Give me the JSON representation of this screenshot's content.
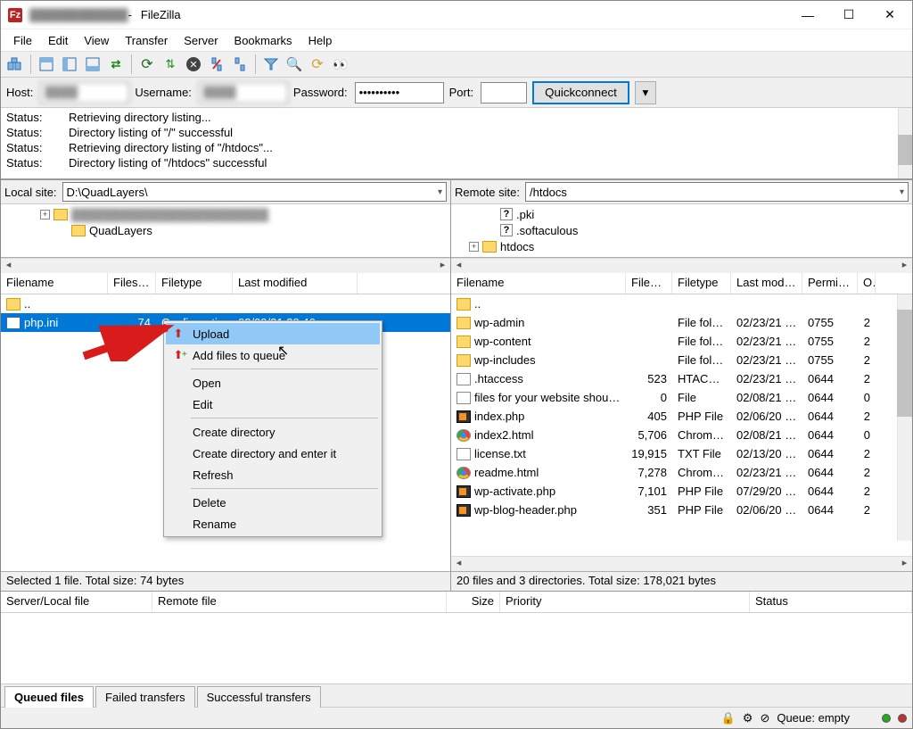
{
  "title": {
    "app_name": "FileZilla"
  },
  "menu": {
    "items": [
      "File",
      "Edit",
      "View",
      "Transfer",
      "Server",
      "Bookmarks",
      "Help"
    ]
  },
  "quickconnect": {
    "host_label": "Host:",
    "username_label": "Username:",
    "password_label": "Password:",
    "password_value": "••••••••••",
    "port_label": "Port:",
    "button": "Quickconnect"
  },
  "log": [
    {
      "label": "Status:",
      "text": "Retrieving directory listing..."
    },
    {
      "label": "Status:",
      "text": "Directory listing of \"/\" successful"
    },
    {
      "label": "Status:",
      "text": "Retrieving directory listing of \"/htdocs\"..."
    },
    {
      "label": "Status:",
      "text": "Directory listing of \"/htdocs\" successful"
    }
  ],
  "local": {
    "site_label": "Local site:",
    "site_path": "D:\\QuadLayers\\",
    "tree": [
      {
        "indent": 40,
        "sq": "+",
        "icon": "fld",
        "label": "",
        "blur": true
      },
      {
        "indent": 60,
        "sq": "",
        "icon": "fld",
        "label": "QuadLayers"
      }
    ],
    "columns": [
      "Filename",
      "Filesize",
      "Filetype",
      "Last modified"
    ],
    "rows": [
      {
        "icon": "fld",
        "name": "..",
        "size": "",
        "type": "",
        "mod": "",
        "sel": false
      },
      {
        "icon": "ini",
        "name": "php.ini",
        "size": "74",
        "type": "Configurati...",
        "mod": "03/09/21 20:46",
        "sel": true
      }
    ],
    "status": "Selected 1 file. Total size: 74 bytes"
  },
  "remote": {
    "site_label": "Remote site:",
    "site_path": "/htdocs",
    "tree": [
      {
        "indent": 36,
        "sq": "",
        "icon": "q",
        "label": ".pki"
      },
      {
        "indent": 36,
        "sq": "",
        "icon": "q",
        "label": ".softaculous"
      },
      {
        "indent": 16,
        "sq": "+",
        "icon": "fld",
        "label": "htdocs"
      }
    ],
    "columns": [
      "Filename",
      "Filesize",
      "Filetype",
      "Last modifi...",
      "Permissi...",
      "O"
    ],
    "rows": [
      {
        "icon": "fld",
        "name": "..",
        "size": "",
        "type": "",
        "mod": "",
        "perm": "",
        "own": ""
      },
      {
        "icon": "fld",
        "name": "wp-admin",
        "size": "",
        "type": "File folder",
        "mod": "02/23/21 0...",
        "perm": "0755",
        "own": "2"
      },
      {
        "icon": "fld",
        "name": "wp-content",
        "size": "",
        "type": "File folder",
        "mod": "02/23/21 0...",
        "perm": "0755",
        "own": "2"
      },
      {
        "icon": "fld",
        "name": "wp-includes",
        "size": "",
        "type": "File folder",
        "mod": "02/23/21 0...",
        "perm": "0755",
        "own": "2"
      },
      {
        "icon": "doc",
        "name": ".htaccess",
        "size": "523",
        "type": "HTACCE...",
        "mod": "02/23/21 0...",
        "perm": "0644",
        "own": "2"
      },
      {
        "icon": "doc",
        "name": "files for your website shoul...",
        "size": "0",
        "type": "File",
        "mod": "02/08/21 1...",
        "perm": "0644",
        "own": "0"
      },
      {
        "icon": "php",
        "name": "index.php",
        "size": "405",
        "type": "PHP File",
        "mod": "02/06/20 2...",
        "perm": "0644",
        "own": "2"
      },
      {
        "icon": "chrome",
        "name": "index2.html",
        "size": "5,706",
        "type": "Chrome ...",
        "mod": "02/08/21 1...",
        "perm": "0644",
        "own": "0"
      },
      {
        "icon": "doc",
        "name": "license.txt",
        "size": "19,915",
        "type": "TXT File",
        "mod": "02/13/20 0...",
        "perm": "0644",
        "own": "2"
      },
      {
        "icon": "chrome",
        "name": "readme.html",
        "size": "7,278",
        "type": "Chrome ...",
        "mod": "02/23/21 0...",
        "perm": "0644",
        "own": "2"
      },
      {
        "icon": "php",
        "name": "wp-activate.php",
        "size": "7,101",
        "type": "PHP File",
        "mod": "07/29/20 0...",
        "perm": "0644",
        "own": "2"
      },
      {
        "icon": "php",
        "name": "wp-blog-header.php",
        "size": "351",
        "type": "PHP File",
        "mod": "02/06/20 2...",
        "perm": "0644",
        "own": "2"
      }
    ],
    "status": "20 files and 3 directories. Total size: 178,021 bytes"
  },
  "context_menu": {
    "items": [
      {
        "label": "Upload",
        "icon": "↑",
        "hl": true
      },
      {
        "label": "Add files to queue",
        "icon": "↑+"
      },
      {
        "sep": true
      },
      {
        "label": "Open"
      },
      {
        "label": "Edit"
      },
      {
        "sep": true
      },
      {
        "label": "Create directory"
      },
      {
        "label": "Create directory and enter it"
      },
      {
        "label": "Refresh"
      },
      {
        "sep": true
      },
      {
        "label": "Delete"
      },
      {
        "label": "Rename"
      }
    ]
  },
  "queue": {
    "columns": [
      "Server/Local file",
      "Remote file",
      "Size",
      "Priority",
      "Status"
    ],
    "tabs": [
      "Queued files",
      "Failed transfers",
      "Successful transfers"
    ],
    "active_tab": 0
  },
  "bottom_bar": {
    "queue_label": "Queue: empty"
  }
}
